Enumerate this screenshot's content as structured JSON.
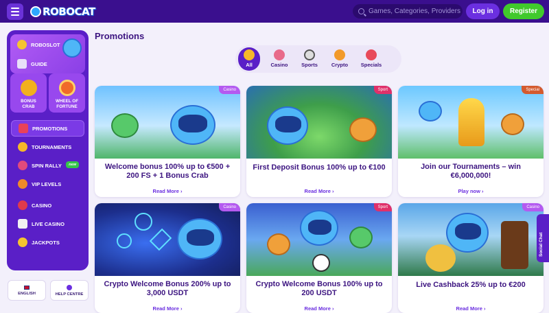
{
  "header": {
    "logo_text": "ROBOCAT",
    "search_placeholder": "Games, Categories, Providers",
    "login_label": "Log in",
    "register_label": "Register",
    "colors": {
      "bar": "#3a0f8e",
      "login": "#6b2fe0",
      "register": "#41c92c"
    }
  },
  "sidebar": {
    "top_items": [
      {
        "label": "ROBOSLOT",
        "icon": "coin-icon"
      },
      {
        "label": "GUIDE",
        "icon": "map-icon"
      }
    ],
    "tiles": [
      {
        "label": "BONUS CRAB",
        "icon": "crab-icon"
      },
      {
        "label": "WHEEL OF FORTUNE",
        "icon": "wheel-icon"
      }
    ],
    "nav": [
      {
        "label": "PROMOTIONS",
        "icon": "gift-icon",
        "active": true
      },
      {
        "label": "TOURNAMENTS",
        "icon": "trophy-icon"
      },
      {
        "label": "SPIN RALLY",
        "icon": "rally-icon",
        "badge": "new"
      },
      {
        "label": "VIP LEVELS",
        "icon": "crown-icon"
      },
      {
        "label": "CASINO",
        "icon": "cherries-icon"
      },
      {
        "label": "LIVE CASINO",
        "icon": "cards-icon"
      },
      {
        "label": "JACKPOTS",
        "icon": "jackpot-icon"
      }
    ],
    "language": "ENGLISH",
    "help": "HELP CENTRE"
  },
  "main": {
    "title": "Promotions",
    "tabs": [
      {
        "label": "All",
        "active": true
      },
      {
        "label": "Casino"
      },
      {
        "label": "Sports"
      },
      {
        "label": "Crypto"
      },
      {
        "label": "Specials"
      }
    ],
    "cards": [
      {
        "tag": "Casino",
        "title": "Welcome bonus 100% up to €500 + 200 FS + 1 Bonus Crab",
        "link": "Read More"
      },
      {
        "tag": "Sport",
        "title": "First Deposit Bonus 100% up to €100",
        "link": "Read More"
      },
      {
        "tag": "Special",
        "title": "Join our Tournaments – win €6,000,000!",
        "link": "Play now"
      },
      {
        "tag": "Casino",
        "title": "Crypto Welcome Bonus 200% up to 3,000 USDT",
        "link": "Read More"
      },
      {
        "tag": "Sport",
        "title": "Crypto Welcome Bonus 100% up to 200 USDT",
        "link": "Read More"
      },
      {
        "tag": "Casino",
        "title": "Live Cashback 25% up to €200",
        "link": "Read More"
      }
    ]
  },
  "social_chat": "Social Chat"
}
